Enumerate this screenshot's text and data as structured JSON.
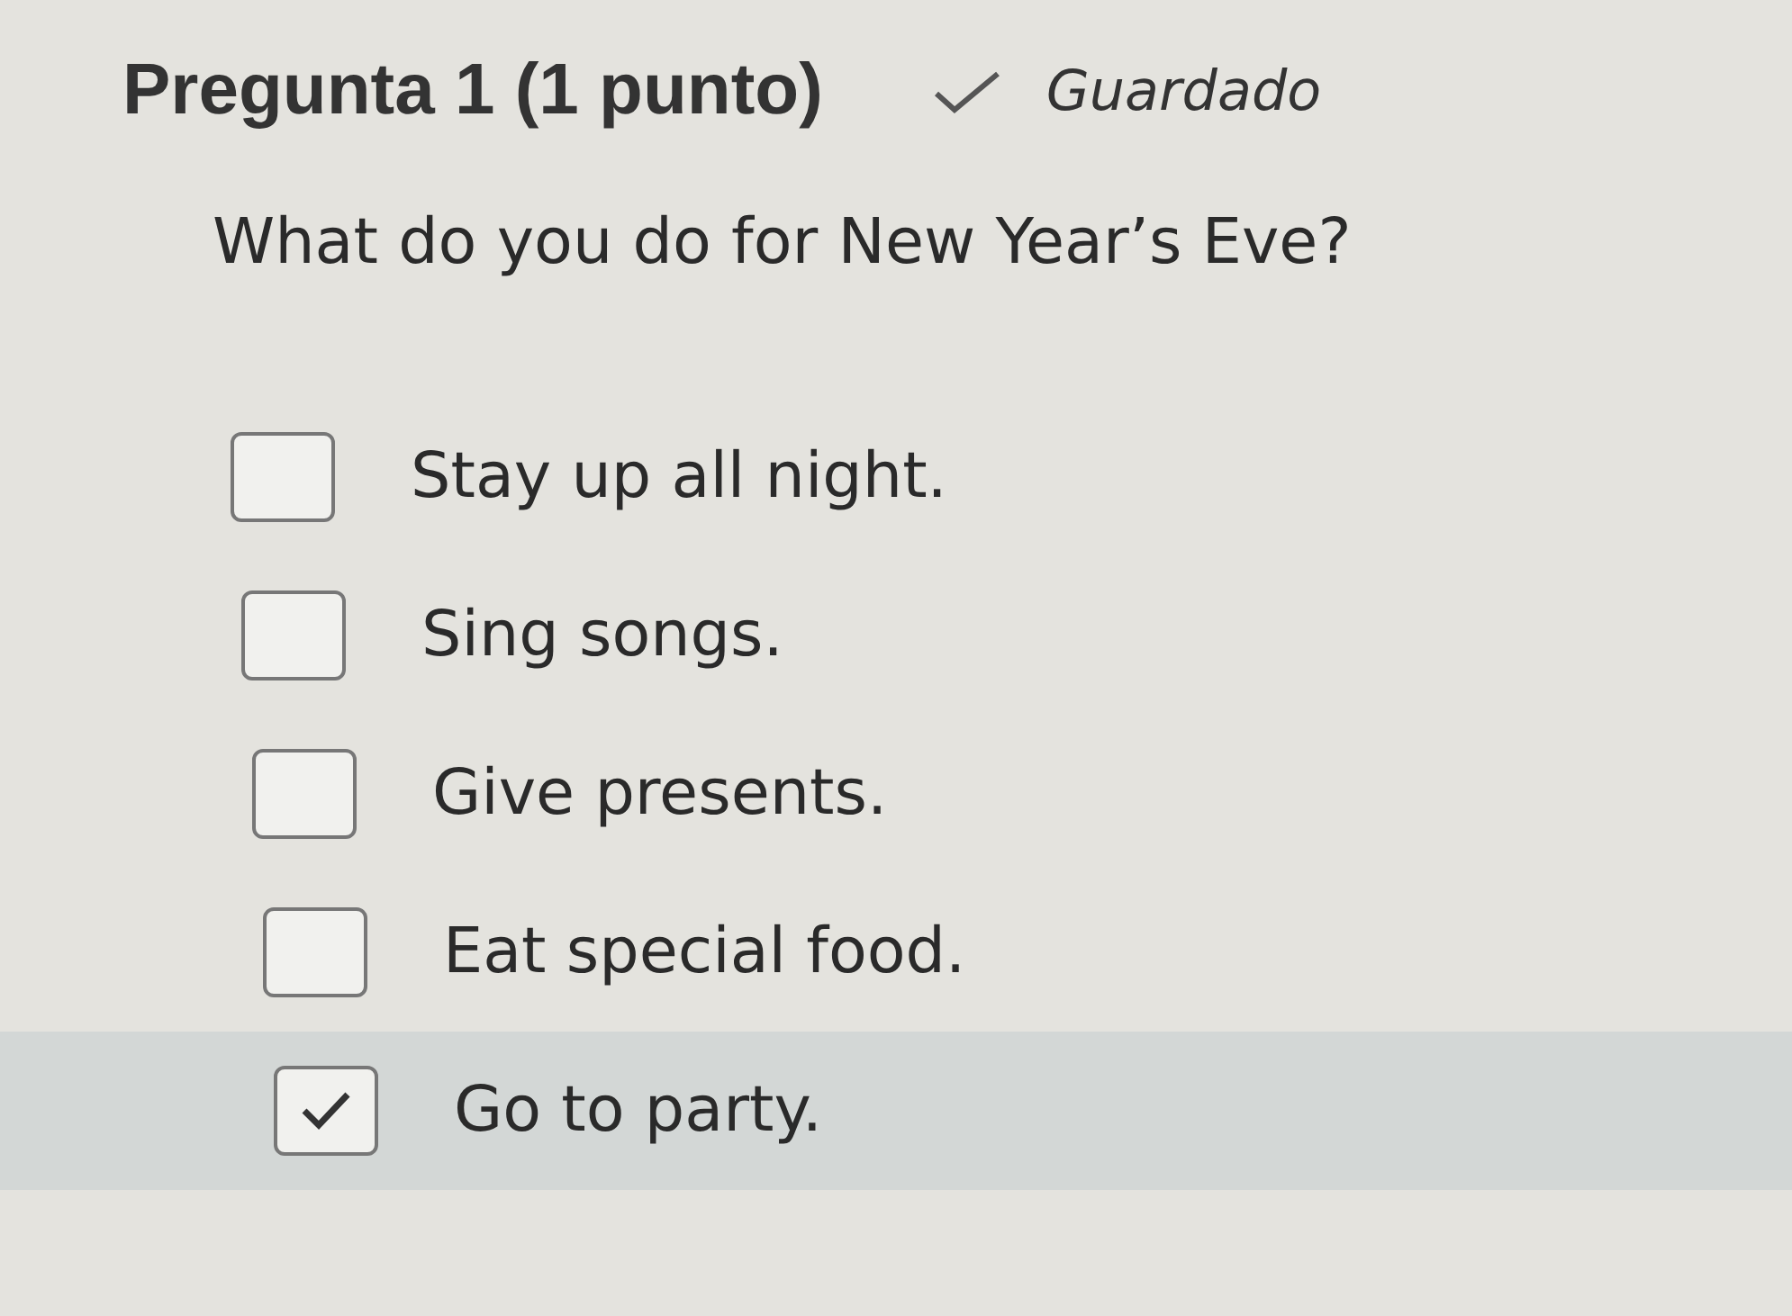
{
  "question": {
    "title": "Pregunta 1 (1 punto)",
    "saved": true,
    "status": "Guardado",
    "prompt": "What do you do for New Year’s Eve?",
    "options": [
      {
        "label": "Stay up all night.",
        "checked": false,
        "hovered": false
      },
      {
        "label": "Sing songs.",
        "checked": false,
        "hovered": false
      },
      {
        "label": "Give presents.",
        "checked": false,
        "hovered": false
      },
      {
        "label": "Eat special food.",
        "checked": false,
        "hovered": false
      },
      {
        "label": "Go to party.",
        "checked": true,
        "hovered": true
      }
    ]
  }
}
